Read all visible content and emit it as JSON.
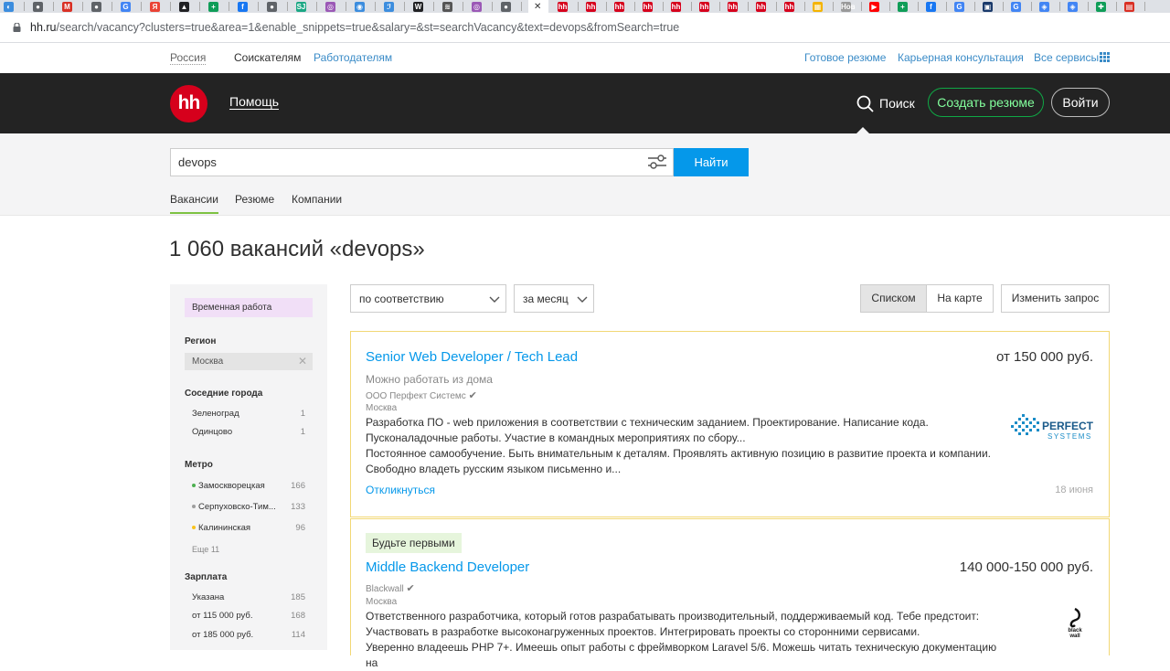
{
  "browser": {
    "url_host": "hh.ru",
    "url_path": "/search/vacancy?clusters=true&area=1&enable_snippets=true&salary=&st=searchVacancy&text=devops&fromSearch=true",
    "tabs": [
      {
        "color": "#3c8dde",
        "glyph": "◐"
      },
      {
        "color": "#5f6368",
        "glyph": "●"
      },
      {
        "color": "#d93025",
        "glyph": "M"
      },
      {
        "color": "#5f6368",
        "glyph": "●"
      },
      {
        "color": "#4285f4",
        "glyph": "G"
      },
      {
        "color": "#ea4335",
        "glyph": "Я"
      },
      {
        "color": "#202124",
        "glyph": "▲"
      },
      {
        "color": "#0f9d58",
        "glyph": "+"
      },
      {
        "color": "#1877f2",
        "glyph": "f"
      },
      {
        "color": "#5f6368",
        "glyph": "●"
      },
      {
        "color": "#1ba784",
        "glyph": "SJ"
      },
      {
        "color": "#9b59b6",
        "glyph": "◎"
      },
      {
        "color": "#3c8dde",
        "glyph": "◉"
      },
      {
        "color": "#3c8dde",
        "glyph": "ℐ"
      },
      {
        "color": "#202124",
        "glyph": "W"
      },
      {
        "color": "#555555",
        "glyph": "≋"
      },
      {
        "color": "#9b59b6",
        "glyph": "◎"
      },
      {
        "color": "#5f6368",
        "glyph": "●"
      }
    ],
    "tabs_right": [
      {
        "color": "#d6001c",
        "glyph": "hh"
      },
      {
        "color": "#d6001c",
        "glyph": "hh"
      },
      {
        "color": "#d6001c",
        "glyph": "hh"
      },
      {
        "color": "#d6001c",
        "glyph": "hh"
      },
      {
        "color": "#d6001c",
        "glyph": "hh"
      },
      {
        "color": "#d6001c",
        "glyph": "hh"
      },
      {
        "color": "#d6001c",
        "glyph": "hh"
      },
      {
        "color": "#d6001c",
        "glyph": "hh"
      },
      {
        "color": "#d6001c",
        "glyph": "hh"
      },
      {
        "color": "#f4b400",
        "glyph": "▦"
      },
      {
        "color": "#999999",
        "glyph": "Нов"
      },
      {
        "color": "#ff0000",
        "glyph": "▶"
      },
      {
        "color": "#0f9d58",
        "glyph": "+"
      },
      {
        "color": "#1877f2",
        "glyph": "f"
      },
      {
        "color": "#4285f4",
        "glyph": "G"
      },
      {
        "color": "#1a3a6b",
        "glyph": "▣"
      },
      {
        "color": "#4285f4",
        "glyph": "G"
      },
      {
        "color": "#4285f4",
        "glyph": "◈"
      },
      {
        "color": "#4285f4",
        "glyph": "◈"
      },
      {
        "color": "#0f9d58",
        "glyph": "✚"
      },
      {
        "color": "#d93025",
        "glyph": "▤"
      }
    ]
  },
  "topline": {
    "region": "Россия",
    "seekers": "Соискателям",
    "employers": "Работодателям",
    "ready_resume": "Готовое резюме",
    "career": "Карьерная консультация",
    "all_services": "Все сервисы"
  },
  "header": {
    "logo": "hh",
    "help": "Помощь",
    "search": "Поиск",
    "create_resume": "Создать резюме",
    "login": "Войти"
  },
  "search": {
    "query": "devops",
    "find": "Найти",
    "tabs": [
      "Вакансии",
      "Резюме",
      "Компании"
    ]
  },
  "title": "1 060 вакансий «devops»",
  "sidebar": {
    "temp_work": "Временная работа",
    "region_h": "Регион",
    "region_value": "Москва",
    "nearby_h": "Соседние города",
    "nearby": [
      {
        "name": "Зеленоград",
        "count": "1"
      },
      {
        "name": "Одинцово",
        "count": "1"
      }
    ],
    "metro_h": "Метро",
    "metro": [
      {
        "name": "Замоскворецкая",
        "count": "166",
        "color": "#4caf50"
      },
      {
        "name": "Серпуховско-Тим...",
        "count": "133",
        "color": "#9e9e9e"
      },
      {
        "name": "Калининская",
        "count": "96",
        "color": "#f9c21b"
      }
    ],
    "metro_more": "Еще 11",
    "salary_h": "Зарплата",
    "salary": [
      {
        "name": "Указана",
        "count": "185"
      },
      {
        "name": "от 115 000 руб.",
        "count": "168"
      },
      {
        "name": "от 185 000 руб.",
        "count": "114"
      }
    ]
  },
  "controls": {
    "sort": "по соответствию",
    "period": "за месяц",
    "list": "Списком",
    "map": "На карте",
    "change": "Изменить запрос"
  },
  "vacancies": [
    {
      "title": "Senior Web Developer / Tech Lead",
      "salary": "от 150 000 руб.",
      "remote": "Можно работать из дома",
      "company": "ООО Перфект Системс",
      "city": "Москва",
      "desc1": "Разработка ПО - web приложения в соответствии с техническим заданием. Проектирование. Написание кода. Пусконаладочные работы. Участие в командных мероприятиях по сбору...",
      "desc2": "Постоянное самообучение. Быть внимательным к деталям. Проявлять активную позицию в развитие проекта и компании. Свободно владеть русским языком письменно и...",
      "apply": "Откликнуться",
      "date": "18 июня",
      "logo_text1": "PERFECT",
      "logo_text2": "SYSTEMS"
    },
    {
      "badge": "Будьте первыми",
      "title": "Middle Backend Developer",
      "salary": "140 000-150 000 руб.",
      "company": "Blackwall",
      "city": "Москва",
      "desc1": "Ответственного разработчика, который готов разрабатывать производительный, поддерживаемый код. Тебе предстоит: Участвовать в разработке высоконагруженных проектов. Интегрировать проекты со сторонними сервисами.",
      "desc2": "Уверенно владеешь PHP 7+. Имеешь опыт работы с фреймворком Laravel 5/6. Можешь читать техническую документацию на",
      "logo_text1": "black",
      "logo_text2": "wall"
    }
  ]
}
